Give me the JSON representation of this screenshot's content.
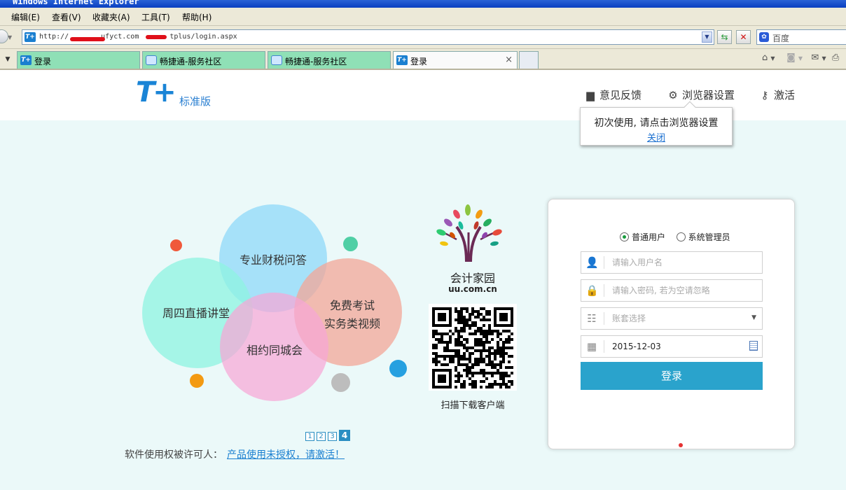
{
  "browser": {
    "title": "Windows Internet Explorer",
    "menu": [
      {
        "label": "编辑(E)"
      },
      {
        "label": "查看(V)"
      },
      {
        "label": "收藏夹(A)"
      },
      {
        "label": "工具(T)"
      },
      {
        "label": "帮助(H)"
      }
    ],
    "address": {
      "url_prefix": "http://",
      "url_host": "ufyct.com",
      "url_path": "tplus/login.aspx"
    },
    "search": {
      "engine": "百度"
    },
    "tabs": [
      {
        "label": "登录",
        "icon": "tplus-icon"
      },
      {
        "label": "畅捷通-服务社区",
        "icon": "community-icon"
      },
      {
        "label": "畅捷通-服务社区",
        "icon": "community-icon"
      },
      {
        "label": "登录",
        "icon": "tplus-icon",
        "active": true
      }
    ]
  },
  "header": {
    "logo": "T+",
    "edition": "标准版",
    "feedback": "意见反馈",
    "browser_settings": "浏览器设置",
    "activate": "激活"
  },
  "tooltip": {
    "message": "初次使用, 请点击浏览器设置",
    "close": "关闭"
  },
  "promo": {
    "bubbles": [
      {
        "label": "专业财税问答",
        "color": "#8fd8f8"
      },
      {
        "label": "周四直播讲堂",
        "color": "#8ef3e0"
      },
      {
        "label": "免费考试",
        "label2": "实务类视频",
        "color": "#f3a597"
      },
      {
        "label": "相约同城会",
        "color": "#f6a6d6"
      }
    ],
    "pages": [
      "1",
      "2",
      "3",
      "4"
    ],
    "active_page": "4",
    "license_label": "软件使用权被许可人：",
    "license_link": "产品使用未授权，请激活！"
  },
  "sponsor": {
    "name": "会计家园",
    "url": "uu.com.cn",
    "qr_caption": "扫描下载客户端"
  },
  "login": {
    "roles": [
      {
        "label": "普通用户",
        "checked": true
      },
      {
        "label": "系统管理员",
        "checked": false
      }
    ],
    "username_placeholder": "请输入用户名",
    "password_placeholder": "请输入密码, 若为空请忽略",
    "account_placeholder": "账套选择",
    "date": "2015-12-03",
    "submit": "登录"
  }
}
